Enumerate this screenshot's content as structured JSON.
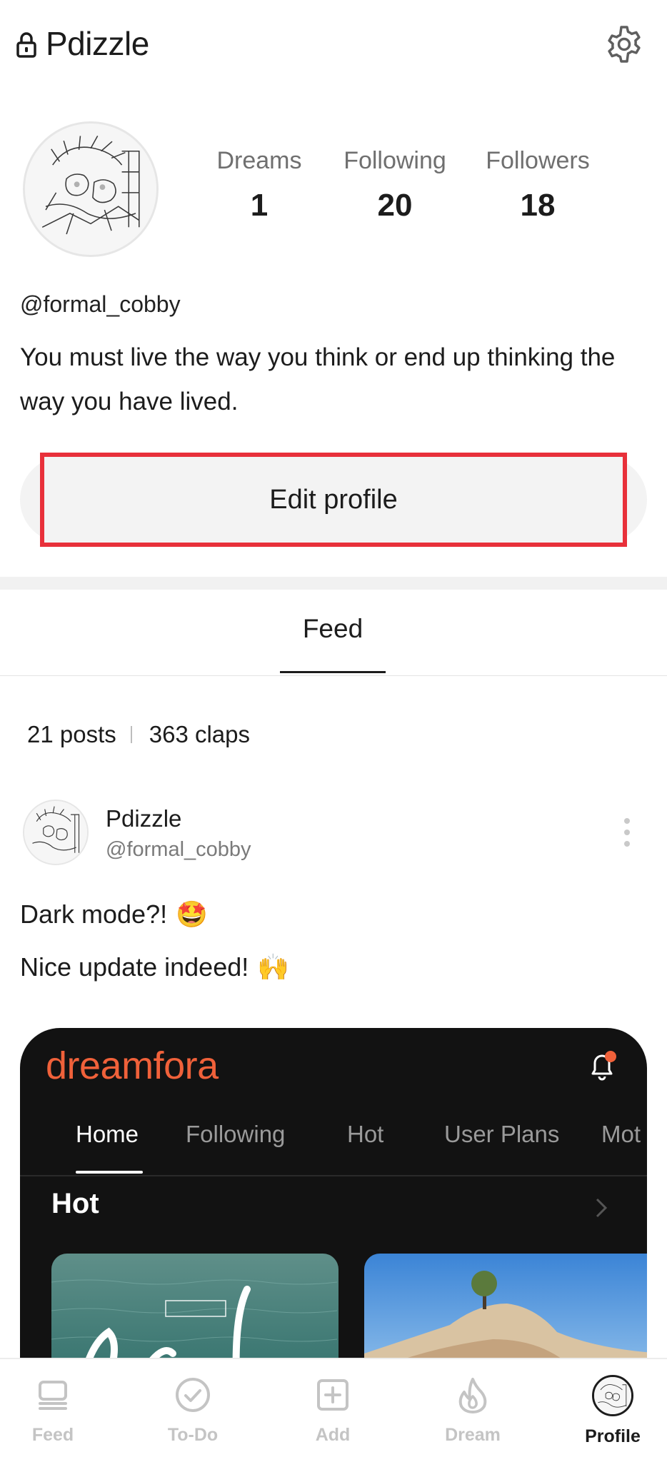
{
  "header": {
    "title": "Pdizzle",
    "lock_icon": "lock-icon",
    "settings_icon": "gear-icon"
  },
  "profile": {
    "stats": [
      {
        "label": "Dreams",
        "value": "1"
      },
      {
        "label": "Following",
        "value": "20"
      },
      {
        "label": "Followers",
        "value": "18"
      }
    ],
    "handle": "@formal_cobby",
    "bio": "You must live the way you think or end up thinking the way you have lived.",
    "edit_label": "Edit profile",
    "highlight_color": "#e8303a"
  },
  "tabs": {
    "feed_label": "Feed"
  },
  "feed": {
    "posts_count": "21 posts",
    "claps_count": "363 claps",
    "post": {
      "author": "Pdizzle",
      "handle": "@formal_cobby",
      "line1": "Dark mode?!",
      "line1_emoji": "🤩",
      "line2": "Nice update indeed!",
      "line2_emoji": "🙌",
      "embedded": {
        "logo": "dreamfora",
        "accent": "#f0613a",
        "tabs": [
          "Home",
          "Following",
          "Hot",
          "User Plans",
          "Mot"
        ],
        "active_tab": "Home",
        "section": "Hot"
      }
    }
  },
  "bottom_nav": {
    "items": [
      {
        "label": "Feed",
        "icon": "feed-icon"
      },
      {
        "label": "To-Do",
        "icon": "check-circle-icon"
      },
      {
        "label": "Add",
        "icon": "plus-square-icon"
      },
      {
        "label": "Dream",
        "icon": "flame-icon"
      },
      {
        "label": "Profile",
        "icon": "avatar"
      }
    ],
    "active": "Profile"
  }
}
